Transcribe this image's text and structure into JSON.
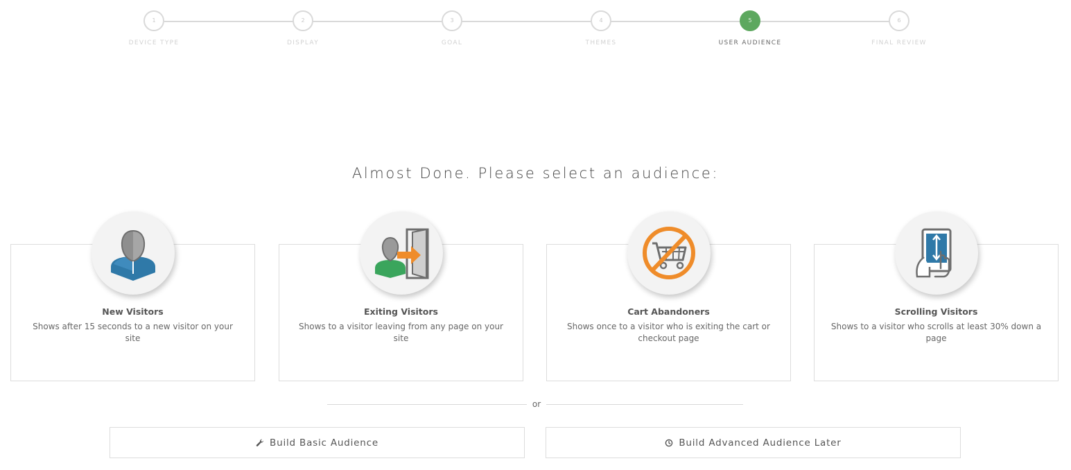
{
  "stepper": {
    "steps": [
      {
        "number": "1",
        "label": "DEVICE TYPE"
      },
      {
        "number": "2",
        "label": "DISPLAY"
      },
      {
        "number": "3",
        "label": "GOAL"
      },
      {
        "number": "4",
        "label": "THEMES"
      },
      {
        "number": "5",
        "label": "USER AUDIENCE"
      },
      {
        "number": "6",
        "label": "FINAL REVIEW"
      }
    ],
    "active_step": 5
  },
  "heading": "Almost Done. Please select an audience:",
  "cards": [
    {
      "icon": "new-visitor-icon",
      "title": "New Visitors",
      "description": "Shows after 15 seconds to a new visitor on your site"
    },
    {
      "icon": "exiting-visitor-icon",
      "title": "Exiting Visitors",
      "description": "Shows to a visitor leaving from any page on your site"
    },
    {
      "icon": "cart-abandoner-icon",
      "title": "Cart Abandoners",
      "description": "Shows once to a visitor who is exiting the cart or checkout page"
    },
    {
      "icon": "scrolling-visitor-icon",
      "title": "Scrolling Visitors",
      "description": "Shows to a visitor who scrolls at least 30% down a page"
    }
  ],
  "divider_text": "or",
  "buttons": {
    "basic": {
      "icon": "wrench-icon",
      "label": "Build Basic Audience"
    },
    "advanced": {
      "icon": "clock-icon",
      "label": "Build Advanced Audience Later"
    }
  },
  "colors": {
    "active_step": "#5da85f",
    "visitor_blue": "#2f79a8",
    "visitor_green": "#3aa55c",
    "accent_orange": "#ef8c2a",
    "icon_gray": "#8e8e8e"
  }
}
